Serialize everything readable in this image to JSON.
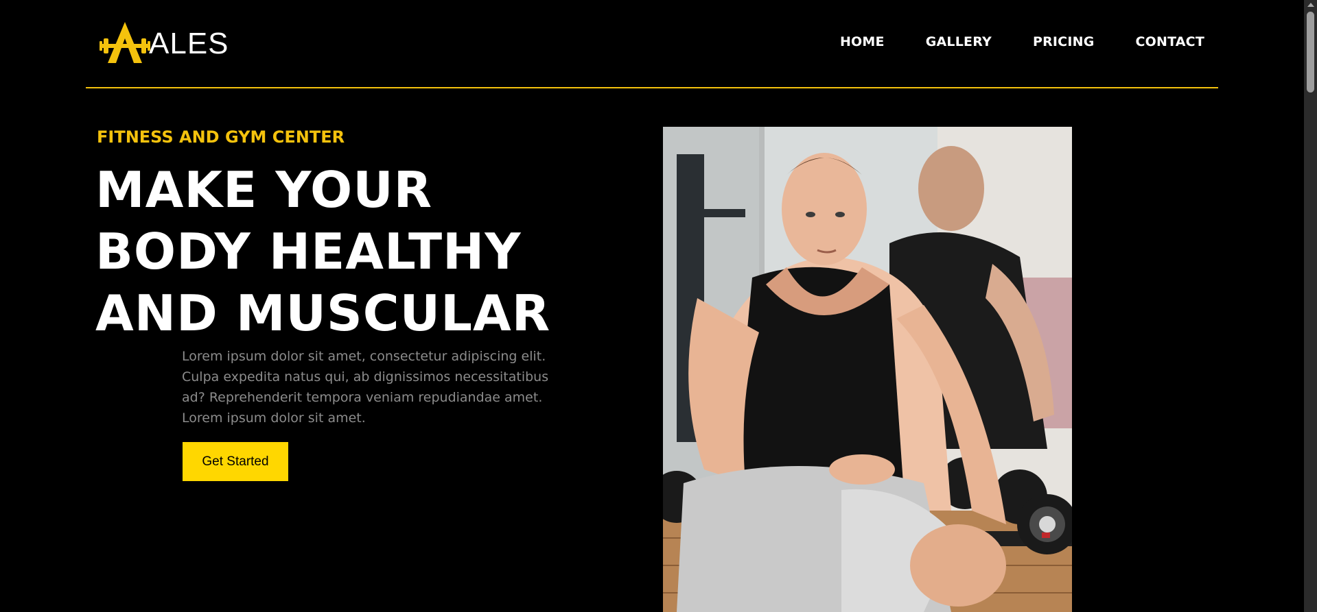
{
  "brand": {
    "logo_icon": "dumbbell-a-icon",
    "name": "ALES",
    "accent": "#f4c20d"
  },
  "nav": {
    "items": [
      {
        "label": "HOME"
      },
      {
        "label": "GALLERY"
      },
      {
        "label": "PRICING"
      },
      {
        "label": "CONTACT"
      }
    ]
  },
  "hero": {
    "eyebrow": "FITNESS AND GYM CENTER",
    "headline": [
      "MAKE YOUR",
      "BODY HEALTHY",
      "AND MUSCULAR"
    ],
    "description": "Lorem ipsum dolor sit amet, consectetur adipiscing elit. Culpa expedita natus qui, ab dignissimos necessitatibus ad? Reprehenderit tempora veniam repudiandae amet. Lorem ipsum dolor sit amet.",
    "cta_label": "Get Started",
    "cta_color": "#ffd700"
  }
}
